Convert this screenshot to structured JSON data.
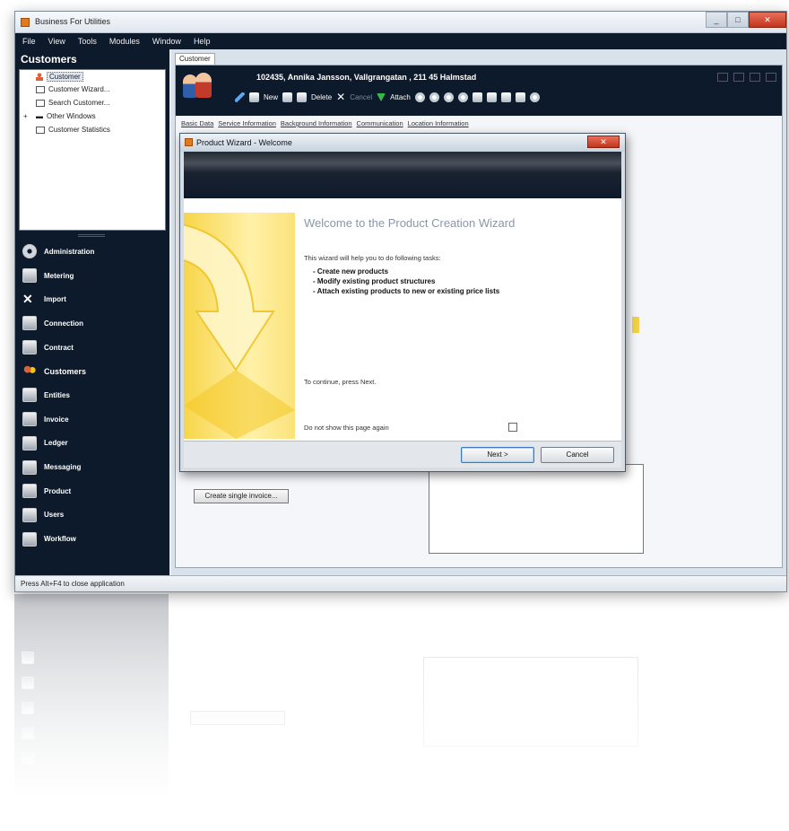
{
  "app": {
    "title": "Business For Utilities",
    "window_buttons": [
      "_",
      "□",
      "✕"
    ]
  },
  "menu": [
    "File",
    "View",
    "Tools",
    "Modules",
    "Window",
    "Help"
  ],
  "left_panel": {
    "header": "Customers",
    "tree": [
      {
        "label": "Customer"
      },
      {
        "label": "Customer Wizard..."
      },
      {
        "label": "Search Customer..."
      },
      {
        "label": "Other Windows"
      },
      {
        "label": "Customer Statistics"
      }
    ],
    "nav": [
      {
        "label": "Administration",
        "icon": "gear-icon"
      },
      {
        "label": "Metering",
        "icon": "meter-icon"
      },
      {
        "label": "Import",
        "icon": "tools-icon"
      },
      {
        "label": "Connection",
        "icon": "connection-icon"
      },
      {
        "label": "Contract",
        "icon": "contract-icon"
      },
      {
        "label": "Customers",
        "icon": "people-icon"
      },
      {
        "label": "Entities",
        "icon": "entities-icon"
      },
      {
        "label": "Invoice",
        "icon": "invoice-icon"
      },
      {
        "label": "Ledger",
        "icon": "ledger-icon"
      },
      {
        "label": "Messaging",
        "icon": "messaging-icon"
      },
      {
        "label": "Product",
        "icon": "product-icon"
      },
      {
        "label": "Users",
        "icon": "users-icon"
      },
      {
        "label": "Workflow",
        "icon": "workflow-icon"
      }
    ]
  },
  "content": {
    "doc_tab": "Customer",
    "customer_header": "102435, Annika Jansson, Vallgrangatan , 211 45 Halmstad",
    "toolbar": {
      "new": "New",
      "delete": "Delete",
      "cancel": "Cancel",
      "attach": "Attach"
    },
    "subtabs": [
      "Basic Data",
      "Service Information",
      "Background Information",
      "Communication",
      "Location Information"
    ],
    "create_button": "Create single invoice..."
  },
  "wizard": {
    "title": "Product Wizard - Welcome",
    "close": "✕",
    "heading": "Welcome to the Product Creation Wizard",
    "intro": "This wizard will help you to do following tasks:",
    "tasks": [
      "- Create new products",
      "- Modify existing product structures",
      "- Attach existing products to new or existing price lists"
    ],
    "continue_text": "To continue, press Next.",
    "dont_show_label": "Do not show this page again",
    "dont_show_checked": false,
    "next_label": "Next >",
    "cancel_label": "Cancel"
  },
  "status_bar": "Press Alt+F4 to close application"
}
